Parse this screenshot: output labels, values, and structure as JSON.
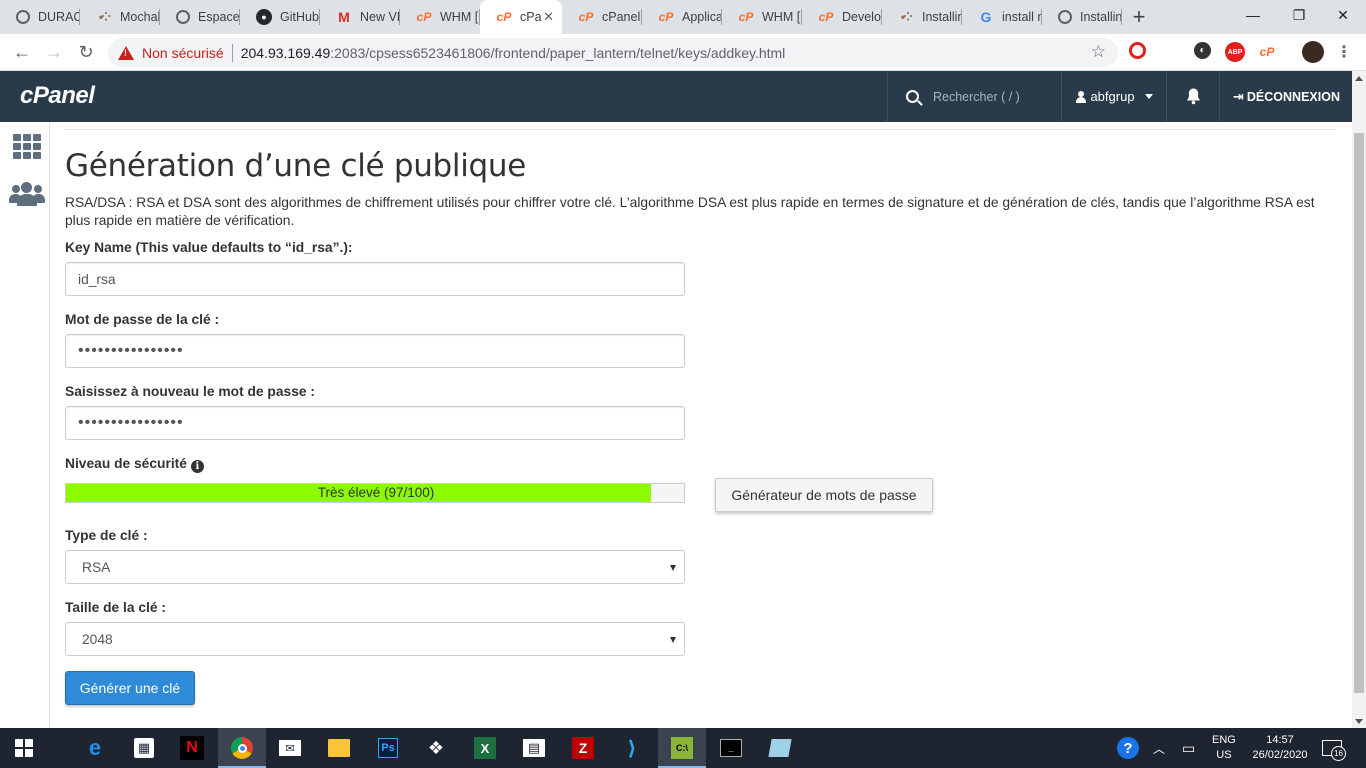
{
  "browser": {
    "tabs": [
      {
        "title": "DURAC",
        "icon": "globe-icon"
      },
      {
        "title": "Mochah",
        "icon": "dots-icon"
      },
      {
        "title": "Espace",
        "icon": "globe-icon"
      },
      {
        "title": "GitHub",
        "icon": "github-icon"
      },
      {
        "title": "New VP",
        "icon": "gmail-icon"
      },
      {
        "title": "WHM [",
        "icon": "cpanel-icon"
      },
      {
        "title": "cPa",
        "icon": "cpanel-icon"
      },
      {
        "title": "cPanel f",
        "icon": "cpanel-icon"
      },
      {
        "title": "Applica",
        "icon": "cpanel-icon"
      },
      {
        "title": "WHM [",
        "icon": "cpanel-icon"
      },
      {
        "title": "Develo",
        "icon": "cpanel-icon"
      },
      {
        "title": "Installin",
        "icon": "dots-icon"
      },
      {
        "title": "install n",
        "icon": "google-icon"
      },
      {
        "title": "Installin",
        "icon": "globe-icon"
      }
    ],
    "not_secure_label": "Non sécurisé",
    "url_host": "204.93.169.49",
    "url_rest": ":2083/cpsess6523461806/frontend/paper_lantern/telnet/keys/addkey.html",
    "extensions": [
      "opera-icon",
      "dark-reader-icon",
      "adblock-icon",
      "cpanel-icon",
      "profile-avatar"
    ]
  },
  "cpanel": {
    "logo": "cPanel",
    "search_placeholder": "Rechercher ( / )",
    "username": "abfgrup",
    "logout_label": "DÉCONNEXION"
  },
  "form": {
    "title": "Génération d’une clé publique",
    "description": "RSA/DSA : RSA et DSA sont des algorithmes de chiffrement utilisés pour chiffrer votre clé. L’algorithme DSA est plus rapide en termes de signature et de génération de clés, tandis que l’algorithme RSA est plus rapide en matière de vérification.",
    "key_name_label": "Key Name (This value defaults to “id_rsa”.):",
    "key_name_value": "id_rsa",
    "password_label": "Mot de passe de la clé :",
    "password_value": "••••••••••••••••",
    "password_confirm_label": "Saisissez à nouveau le mot de passe :",
    "password_confirm_value": "••••••••••••••••",
    "strength_label": "Niveau de sécurité",
    "strength_text": "Très élevé (97/100)",
    "strength_value": 97,
    "strength_color": "#8cfb00",
    "generator_button": "Générateur de mots de passe",
    "key_type_label": "Type de clé :",
    "key_type_value": "RSA",
    "key_size_label": "Taille de la clé :",
    "key_size_value": "2048",
    "submit_button": "Générer une clé"
  },
  "taskbar": {
    "apps": [
      "edge-icon",
      "store-icon",
      "netflix-icon",
      "chrome-icon",
      "mail-icon",
      "file-explorer-icon",
      "photoshop-icon",
      "dropbox-icon",
      "excel-icon",
      "video-editor-icon",
      "filezilla-icon",
      "vscode-icon",
      "terminal-app-icon",
      "cmd-icon",
      "notepad-icon"
    ],
    "lang_top": "ENG",
    "lang_bottom": "US",
    "time": "14:57",
    "date": "26/02/2020",
    "notification_count": "16"
  }
}
